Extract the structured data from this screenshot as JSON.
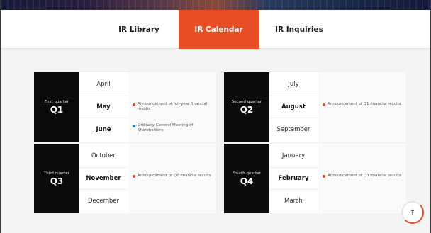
{
  "tabs": [
    {
      "label": "IR Library",
      "active": false
    },
    {
      "label": "IR Calendar",
      "active": true
    },
    {
      "label": "IR Inquiries",
      "active": false
    }
  ],
  "colors": {
    "accent": "#e84e24",
    "dot_red": "#e84e24",
    "dot_blue": "#2a8fd8",
    "label_bg": "#0b0b0b"
  },
  "quarters": [
    {
      "subtitle": "First quarter",
      "name": "Q1",
      "months": [
        "April",
        "May",
        "June"
      ],
      "events": [
        {
          "text": "Announcement of full-year financial results",
          "dot": "red"
        },
        {
          "text": "Ordinary General Meeting of Shareholders",
          "dot": "blue"
        }
      ]
    },
    {
      "subtitle": "Second quarter",
      "name": "Q2",
      "months": [
        "July",
        "August",
        "September"
      ],
      "events": [
        {
          "text": "Announcement of Q1 financial results",
          "dot": "red"
        }
      ]
    },
    {
      "subtitle": "Third quarter",
      "name": "Q3",
      "months": [
        "October",
        "November",
        "December"
      ],
      "events": [
        {
          "text": "Announcement of Q2 financial results",
          "dot": "red"
        }
      ]
    },
    {
      "subtitle": "Fourth quarter",
      "name": "Q4",
      "months": [
        "January",
        "February",
        "March"
      ],
      "events": [
        {
          "text": "Announcement of Q3 financial results",
          "dot": "red"
        }
      ]
    }
  ],
  "scroll_top": {
    "icon": "arrow-up-icon",
    "glyph": "↑"
  }
}
